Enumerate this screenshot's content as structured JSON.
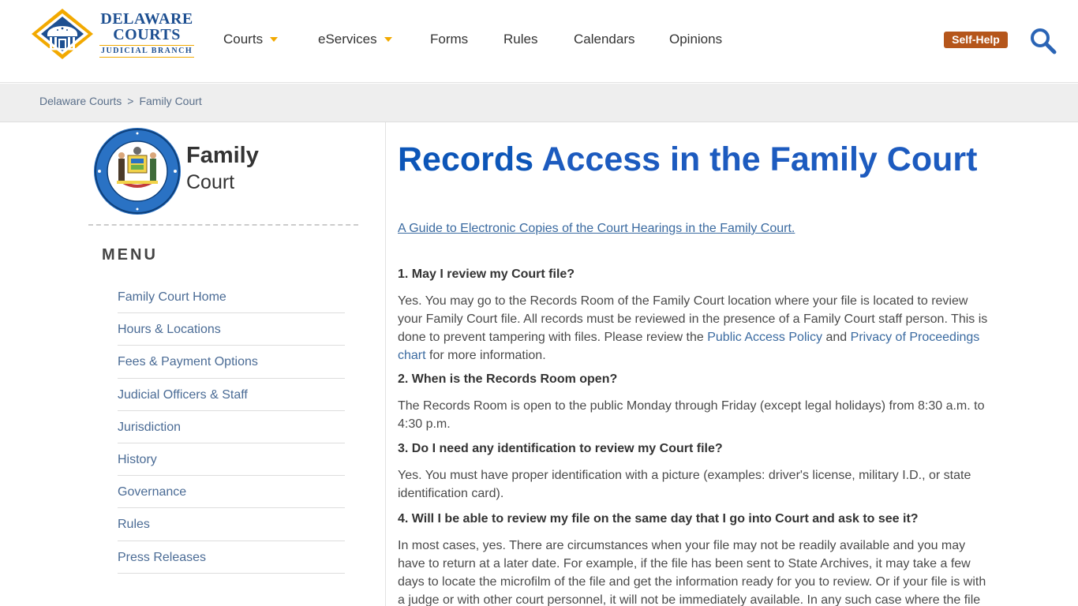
{
  "header": {
    "logo": {
      "line1": "DELAWARE",
      "line2": "COURTS",
      "line3": "JUDICIAL BRANCH"
    },
    "nav": [
      {
        "label": "Courts",
        "has_dropdown": true
      },
      {
        "label": "eServices",
        "has_dropdown": true
      },
      {
        "label": "Forms",
        "has_dropdown": false
      },
      {
        "label": "Rules",
        "has_dropdown": false
      },
      {
        "label": "Calendars",
        "has_dropdown": false
      },
      {
        "label": "Opinions",
        "has_dropdown": false
      }
    ],
    "self_help_label": "Self-Help",
    "search_icon": "search-icon"
  },
  "breadcrumb": {
    "items": [
      "Delaware Courts",
      "Family Court"
    ],
    "separator": ">"
  },
  "sidebar": {
    "court_name_line1": "Family",
    "court_name_line2": "Court",
    "menu_title": "MENU",
    "items": [
      "Family Court Home",
      "Hours & Locations",
      "Fees & Payment Options",
      "Judicial Officers & Staff",
      "Jurisdiction",
      "History",
      "Governance",
      "Rules",
      "Press Releases"
    ]
  },
  "main": {
    "title_bold": "Records",
    "title_rest": "Access in the Family Court",
    "guide_link": "A Guide to Electronic Copies of the Court Hearings in the Family Court.",
    "qa": [
      {
        "q": "1. May I review my Court file?",
        "a_part1": "Yes.  You may go to the Records Room of the Family Court location where your file is located to review your Family Court file.  All records must be reviewed in the presence of a Family Court staff person.  This is done to prevent tampering with files. Please review the ",
        "link1": "Public Access Policy",
        "a_part2": " and ",
        "link2": "Privacy of Proceedings chart",
        "a_part3": " for more information."
      },
      {
        "q": "2. When is the Records Room open?",
        "a": "The Records Room is open to the public Monday through Friday (except legal holidays) from 8:30 a.m. to 4:30 p.m."
      },
      {
        "q": "3. Do I need any identification to review my Court file?",
        "a": "Yes.  You must have proper identification with a picture (examples:  driver's license, military I.D., or state identification card)."
      },
      {
        "q": "4. Will I be able to review my file on the same day that I go into Court and ask to see it?",
        "a": "In most cases, yes.  There are circumstances when your file may not be readily available and you may have to return at a later date.  For example, if the file has been sent to State Archives, it may take a few days to locate the microfilm of the file and get the information ready for you to review.  Or if your file is with a judge or with other court personnel, it will not be immediately available.  In any such case where the file is not"
      }
    ]
  },
  "colors": {
    "brand_blue": "#1d4f91",
    "brand_gold": "#f2a900",
    "title_blue": "#0d56b8",
    "link_blue": "#3a6aa0",
    "self_help_bg": "#b5561b",
    "breadcrumb_bg": "#eeeeee"
  }
}
